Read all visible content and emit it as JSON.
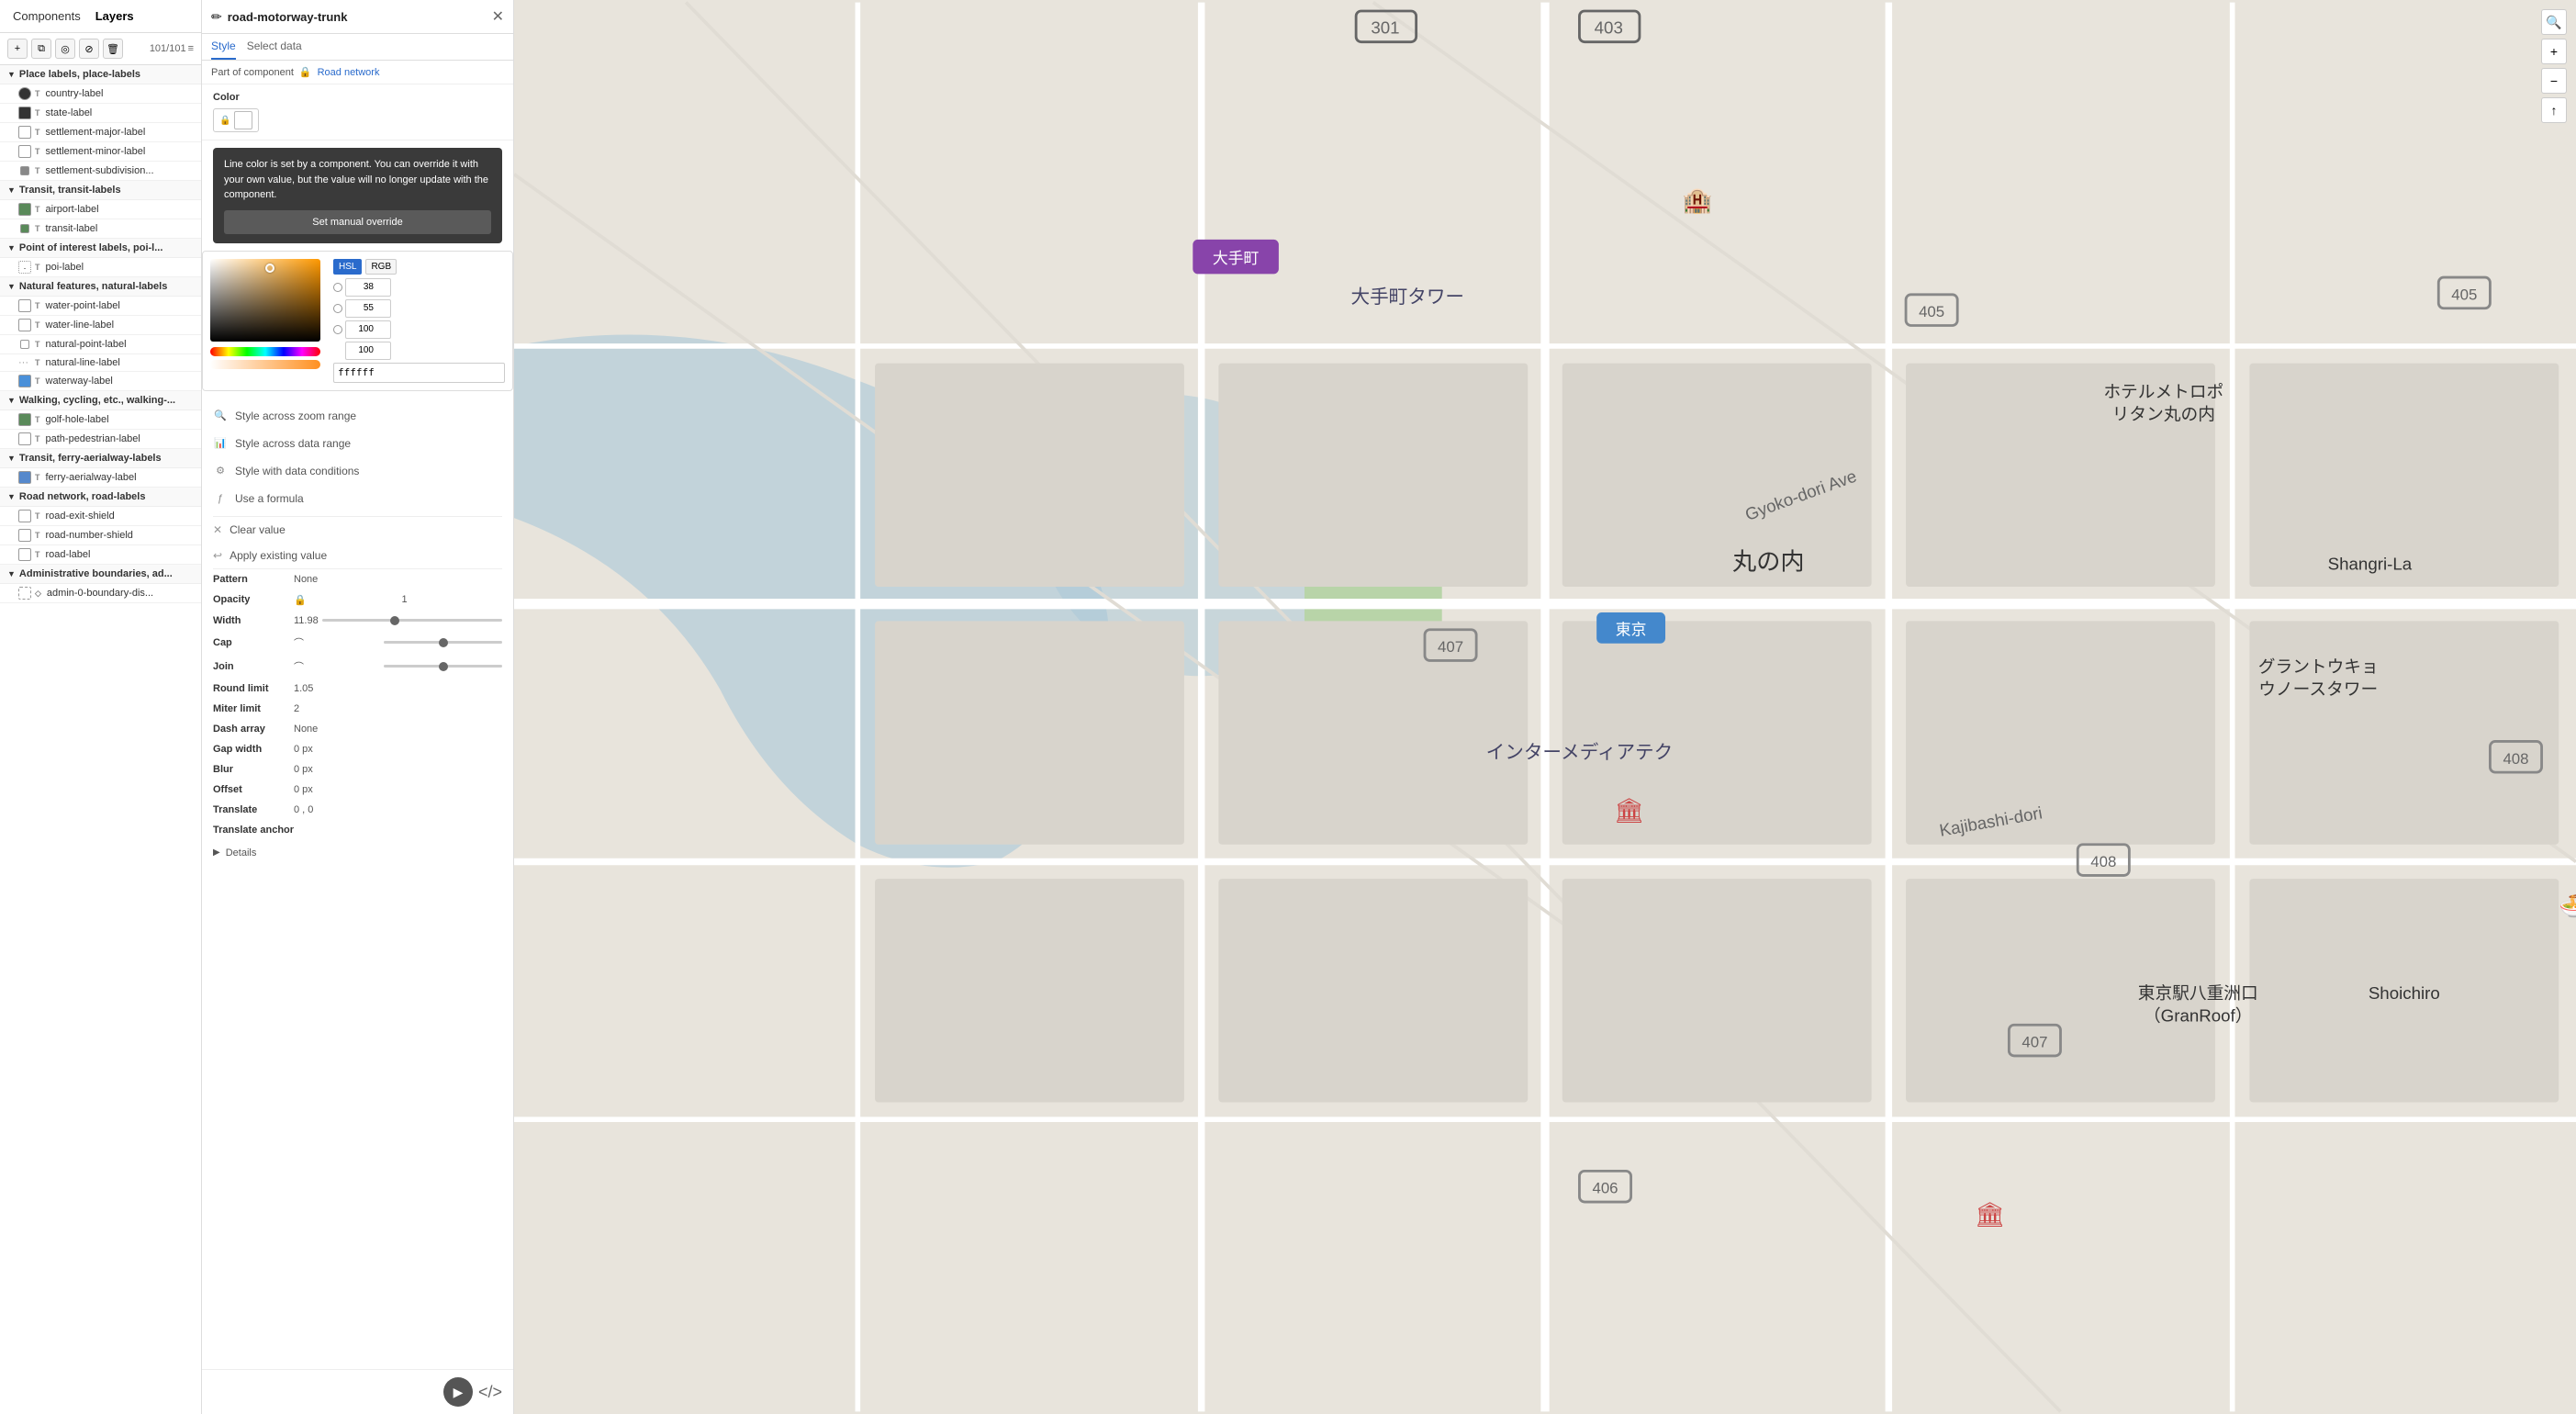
{
  "leftPanel": {
    "tabs": [
      {
        "id": "components",
        "label": "Components",
        "active": false
      },
      {
        "id": "layers",
        "label": "Layers",
        "active": true
      }
    ],
    "toolbar": {
      "addLabel": "+",
      "copyLabel": "⧉",
      "visibilityLabel": "◎",
      "filterLabel": "⊘",
      "trashLabel": "🗑",
      "filterIconLabel": "≡",
      "count": "101/101"
    },
    "groups": [
      {
        "id": "place-labels",
        "label": "Place labels, place-labels",
        "items": [
          {
            "icon": "circle-dark",
            "type": "T",
            "label": "country-label"
          },
          {
            "icon": "square-dark",
            "type": "T",
            "label": "state-label"
          },
          {
            "icon": "square-border",
            "type": "T",
            "label": "settlement-major-label"
          },
          {
            "icon": "square-border",
            "type": "T",
            "label": "settlement-minor-label"
          },
          {
            "icon": "square-dark-sm",
            "type": "T",
            "label": "settlement-subdivision..."
          }
        ]
      },
      {
        "id": "transit-labels",
        "label": "Transit, transit-labels",
        "items": [
          {
            "icon": "square-green",
            "type": "T",
            "label": "airport-label"
          },
          {
            "icon": "square-green-sm",
            "type": "T",
            "label": "transit-label"
          }
        ]
      },
      {
        "id": "poi-labels",
        "label": "Point of interest labels, poi-l...",
        "items": [
          {
            "icon": "square-dots",
            "type": "T",
            "label": "poi-label"
          }
        ]
      },
      {
        "id": "natural-features",
        "label": "Natural features, natural-labels",
        "items": [
          {
            "icon": "square-empty",
            "type": "T",
            "label": "water-point-label"
          },
          {
            "icon": "square-empty",
            "type": "T",
            "label": "water-line-label"
          },
          {
            "icon": "square-sm",
            "type": "T",
            "label": "natural-point-label"
          },
          {
            "icon": "dots-icon",
            "type": "T",
            "label": "natural-line-label"
          },
          {
            "icon": "square-blue-filled",
            "type": "T",
            "label": "waterway-label"
          }
        ]
      },
      {
        "id": "walking-cycling",
        "label": "Walking, cycling, etc., walking-...",
        "items": [
          {
            "icon": "square-green-filled",
            "type": "T",
            "label": "golf-hole-label"
          },
          {
            "icon": "square-border-sm",
            "type": "T",
            "label": "path-pedestrian-label"
          }
        ]
      },
      {
        "id": "transit-ferry",
        "label": "Transit, ferry-aerialway-labels",
        "items": [
          {
            "icon": "square-blue",
            "type": "T",
            "label": "ferry-aerialway-label"
          }
        ]
      },
      {
        "id": "road-network",
        "label": "Road network, road-labels",
        "items": [
          {
            "icon": "square-border",
            "type": "T",
            "label": "road-exit-shield"
          },
          {
            "icon": "square-border",
            "type": "T",
            "label": "road-number-shield"
          },
          {
            "icon": "square-border",
            "type": "T",
            "label": "road-label"
          }
        ]
      },
      {
        "id": "admin-boundaries",
        "label": "Administrative boundaries, ad...",
        "items": [
          {
            "icon": "square-edit",
            "type": "◇",
            "label": "admin-0-boundary-dis..."
          }
        ]
      }
    ]
  },
  "middlePanel": {
    "title": "road-motorway-trunk",
    "editIcon": "✏",
    "tabs": [
      {
        "label": "Style",
        "active": true
      },
      {
        "label": "Select data",
        "active": false
      }
    ],
    "componentBar": {
      "text": "Part of component",
      "lockIcon": "🔒",
      "linkText": "Road network"
    },
    "sections": {
      "color": {
        "label": "Color",
        "lockIcon": "🔒",
        "swatchColor": "#ffffff"
      },
      "overrideBox": {
        "text": "Line color is set by a component. You can override it with your own value, but the value will no longer update with the component.",
        "buttonLabel": "Set manual override"
      },
      "colorPicker": {
        "hsl": "HSL",
        "rgb": "RGB",
        "h": 38,
        "s": 55,
        "l": 100,
        "alpha": 100,
        "hex": "ffffff"
      },
      "pattern": {
        "label": "Pattern",
        "value": "None"
      },
      "opacity": {
        "label": "Opacity",
        "lockIcon": "🔒",
        "value": "1"
      },
      "width": {
        "label": "Width",
        "lockIcon": "—",
        "value": "11.98"
      },
      "cap": {
        "label": "Cap",
        "lockIcon": "⌒",
        "value": ""
      },
      "join": {
        "label": "Join",
        "lockIcon": "⌒",
        "value": ""
      },
      "roundLimit": {
        "label": "Round limit",
        "value": "1.05"
      },
      "miterLimit": {
        "label": "Miter limit",
        "value": "2"
      },
      "dashArray": {
        "label": "Dash array",
        "value": "None"
      },
      "gapWidth": {
        "label": "Gap width",
        "value": "0 px"
      },
      "blur": {
        "label": "Blur",
        "value": "0 px"
      },
      "offset": {
        "label": "Offset",
        "value": "0 px"
      },
      "translate": {
        "label": "Translate",
        "value": "0 , 0"
      },
      "translateAnchor": {
        "label": "Translate anchor"
      }
    },
    "styleOptions": [
      {
        "icon": "🔍",
        "label": "Style across zoom range"
      },
      {
        "icon": "📊",
        "label": "Style across data range"
      },
      {
        "icon": "⚙",
        "label": "Style with data conditions"
      },
      {
        "icon": "ƒ",
        "label": "Use a formula"
      }
    ],
    "actionOptions": [
      {
        "icon": "✕",
        "label": "Clear value"
      },
      {
        "icon": "↩",
        "label": "Apply existing value"
      }
    ],
    "details": {
      "label": "Details"
    },
    "bottomBar": {
      "playIcon": "▶",
      "codeIcon": "</>"
    }
  },
  "mapSearch": {
    "icon": "🔍"
  }
}
